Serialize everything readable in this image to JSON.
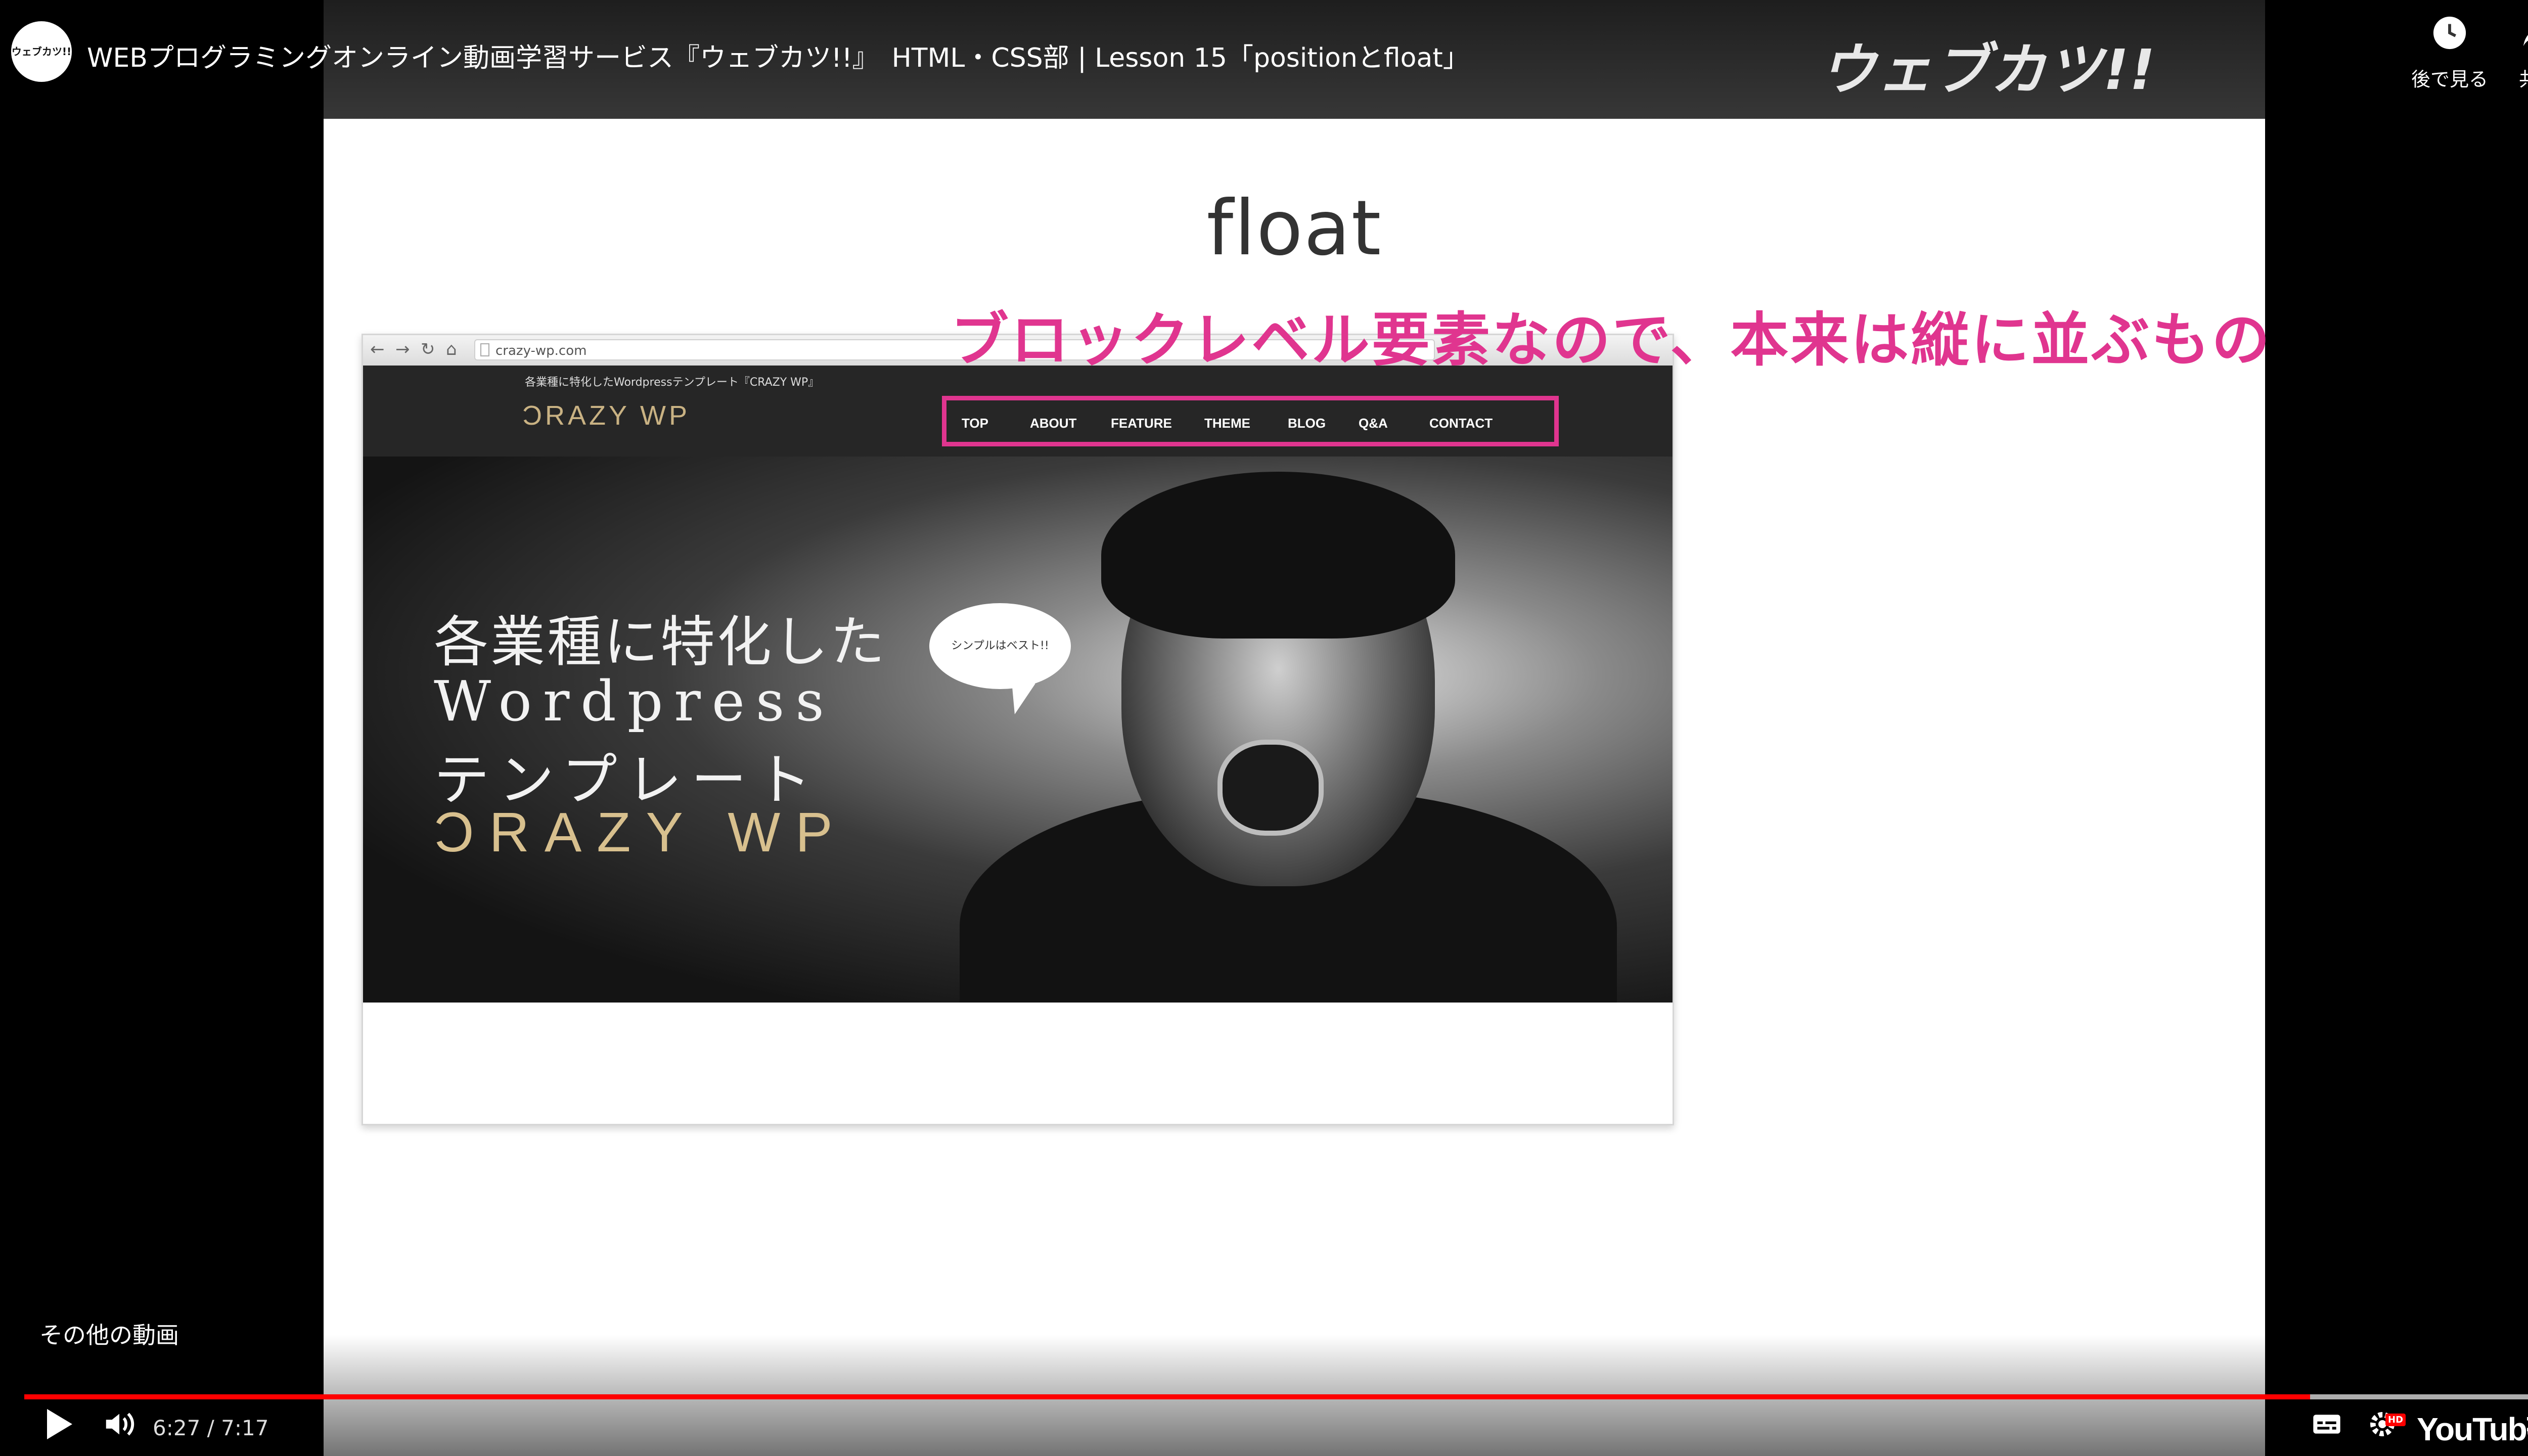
{
  "video": {
    "title": "WEBプログラミングオンライン動画学習サービス『ウェブカツ!!』　HTML・CSS部 | Lesson 15「positionとfloat」",
    "channel_avatar_text": "ウェブカツ!!",
    "brand_logo": "ウェブカツ!!",
    "watch_later_label": "後で見る",
    "share_label": "共有",
    "more_videos_label": "その他の動画",
    "current_time": "6:27",
    "duration": "7:17",
    "time_display": "6:27 / 7:17",
    "progress": 0.8998,
    "buffered": 1.0,
    "youtube_logo": "YouTube",
    "hd_badge": "HD",
    "accent_color": "#ff0000"
  },
  "slide": {
    "title": "float",
    "annotation": "ブロックレベル要素なので、本来は縦に並ぶもの",
    "annotation_color": "#e0358f",
    "browser": {
      "url": "crazy-wp.com",
      "site_tagline": "各業種に特化したWordpressテンプレート『CRAZY WP』",
      "site_logo": "ƆRAZY WP",
      "nav": [
        "TOP",
        "ABOUT",
        "FEATURE",
        "THEME",
        "BLOG",
        "Q&A",
        "CONTACT"
      ],
      "hero_lines": [
        "各業種に特化した",
        "Wordpress",
        "テンプレート",
        "ƆRAZY  WP"
      ],
      "bubble_text": "シンプルはベスト!!"
    }
  },
  "icons": {
    "watch_later": "clock-icon",
    "share": "share-arrow-icon",
    "play": "play-icon",
    "volume": "volume-icon",
    "subtitles": "subtitles-icon",
    "settings": "gear-icon",
    "exit_fullscreen": "exit-fullscreen-icon"
  }
}
